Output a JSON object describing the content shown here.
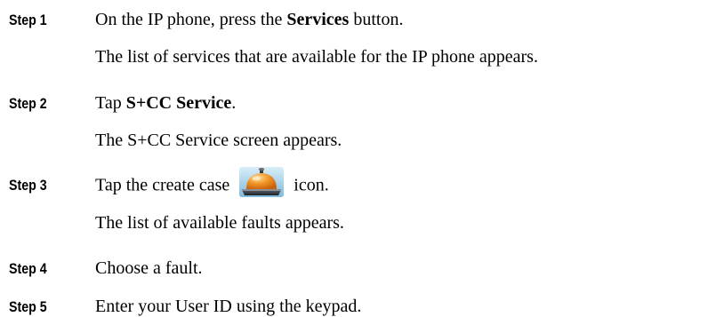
{
  "steps": [
    {
      "label": "Step 1",
      "instruction": {
        "pre": "On the IP phone, press the ",
        "bold": "Services",
        "post": " button."
      },
      "result": "The list of services that are available for the IP phone appears."
    },
    {
      "label": "Step 2",
      "instruction": {
        "pre": "Tap ",
        "bold": "S+CC Service",
        "post": "."
      },
      "result": "The S+CC Service screen appears."
    },
    {
      "label": "Step 3",
      "instruction": {
        "pre": "Tap the create case ",
        "icon": "bell-icon",
        "post": " icon."
      },
      "result": "The list of available faults appears."
    },
    {
      "label": "Step 4",
      "instruction": {
        "pre": "Choose a fault."
      }
    },
    {
      "label": "Step 5",
      "instruction": {
        "pre": "Enter your User ID using the keypad."
      }
    }
  ]
}
